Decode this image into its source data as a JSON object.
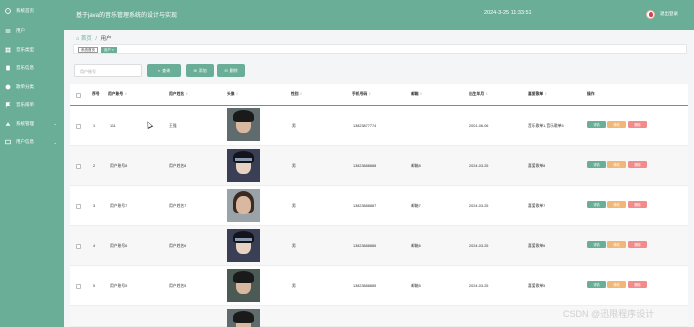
{
  "colors": {
    "accent": "#6aae98",
    "edit": "#f0b776",
    "delete": "#f08c8c"
  },
  "sidebar": {
    "items": [
      {
        "label": "系统首页",
        "icon": "home-icon"
      },
      {
        "label": "用户",
        "icon": "user-icon"
      },
      {
        "label": "音乐类型",
        "icon": "grid-icon"
      },
      {
        "label": "音乐信息",
        "icon": "music-icon"
      },
      {
        "label": "歌单分类",
        "icon": "list-icon"
      },
      {
        "label": "音乐排单",
        "icon": "flag-icon"
      },
      {
        "label": "系统管理",
        "icon": "settings-icon",
        "arrow": "⌄"
      },
      {
        "label": "用户信息",
        "icon": "card-icon",
        "arrow": "⌄"
      }
    ]
  },
  "header": {
    "title": "基于java的音乐管理系统的设计与实现",
    "time": "2024-3-25 11:33:51",
    "logout": "退出登录"
  },
  "breadcrumb": {
    "home": "⌂ 首页",
    "sep": "/",
    "current": "用户"
  },
  "tabs": [
    {
      "label": "系统首页",
      "active": false
    },
    {
      "label": "用户 ×",
      "active": true
    }
  ],
  "search": {
    "placeholder": "用户账号",
    "search_label": "查询",
    "add_label": "添加",
    "delete_label": "删除"
  },
  "table": {
    "headers": [
      "序号",
      "用户账号",
      "用户姓名",
      "头像",
      "性别",
      "手机号码",
      "邮箱",
      "出生年月",
      "喜爱歌单",
      "操作"
    ],
    "rows": [
      {
        "index": "1",
        "account": "111",
        "name": "王强",
        "gender": "男",
        "phone": "13823877774",
        "email": "",
        "birth": "2001-06-06",
        "fav": "音乐歌单1,音乐歌单5",
        "avatar": "boy"
      },
      {
        "index": "2",
        "account": "用户账号8",
        "name": "用户姓名8",
        "gender": "男",
        "phone": "13823888888",
        "email": "邮箱8",
        "birth": "2024-03-25",
        "fav": "喜爱歌单8",
        "avatar": "anime"
      },
      {
        "index": "3",
        "account": "用户账号7",
        "name": "用户姓名7",
        "gender": "男",
        "phone": "13823888887",
        "email": "邮箱7",
        "birth": "2024-03-25",
        "fav": "喜爱歌单7",
        "avatar": "girl"
      },
      {
        "index": "4",
        "account": "用户账号6",
        "name": "用户姓名6",
        "gender": "男",
        "phone": "13823888886",
        "email": "邮箱6",
        "birth": "2024-03-25",
        "fav": "喜爱歌单6",
        "avatar": "anime"
      },
      {
        "index": "5",
        "account": "用户账号5",
        "name": "用户姓名5",
        "gender": "男",
        "phone": "13823888885",
        "email": "邮箱5",
        "birth": "2024-03-25",
        "fav": "喜爱歌单5",
        "avatar": "real"
      }
    ],
    "actions": {
      "view": "详情",
      "edit": "修改",
      "delete": "删除"
    }
  },
  "watermark": "CSDN @迅限程序设计"
}
